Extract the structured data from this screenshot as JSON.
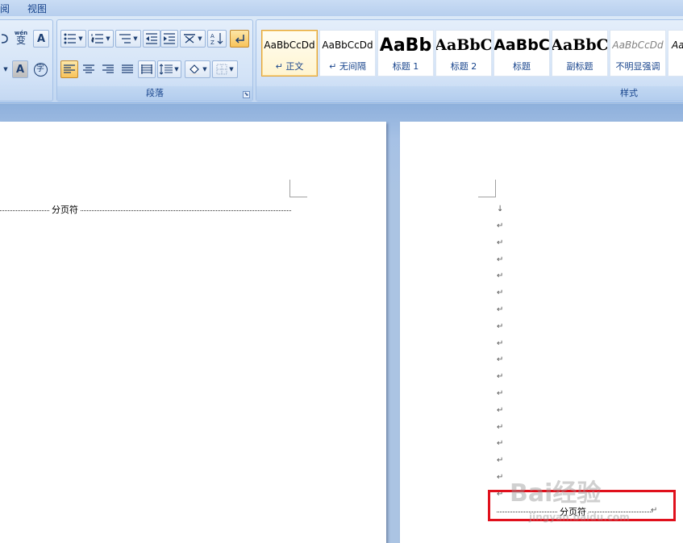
{
  "menu_tabs": [
    {
      "label": "阅"
    },
    {
      "label": "视图"
    }
  ],
  "paragraph_group": {
    "label": "段落",
    "launcher": "⬊"
  },
  "styles_group": {
    "label": "样式",
    "tiles": [
      {
        "sample": "AaBbCcDd",
        "name": "↵ 正文"
      },
      {
        "sample": "AaBbCcDd",
        "name": "↵ 无间隔"
      },
      {
        "sample": "AaBb",
        "name": "标题 1"
      },
      {
        "sample": "AaBbC",
        "name": "标题 2"
      },
      {
        "sample": "AaBbC",
        "name": "标题"
      },
      {
        "sample": "AaBbC",
        "name": "副标题"
      },
      {
        "sample": "AaBbCcDd",
        "name": "不明显强调"
      },
      {
        "sample": "Aa",
        "name": ""
      }
    ]
  },
  "font_group": {
    "phonetic_label": "wén",
    "phonetic_char": "变",
    "border_char": "A",
    "shade_char": "A",
    "enclose_char": "字"
  },
  "document": {
    "left_page_break_label": "分页符",
    "right_page_break_label": "分页符",
    "paragraph_mark": "↵",
    "first_mark": "↓",
    "para_marks_count": 17
  },
  "watermark": {
    "brand": "Bai经验",
    "url": "jingyan.baidu.com"
  },
  "colors": {
    "highlight": "#e0101c",
    "active_button": "#f8c35a",
    "ribbon_text": "#15428b"
  }
}
